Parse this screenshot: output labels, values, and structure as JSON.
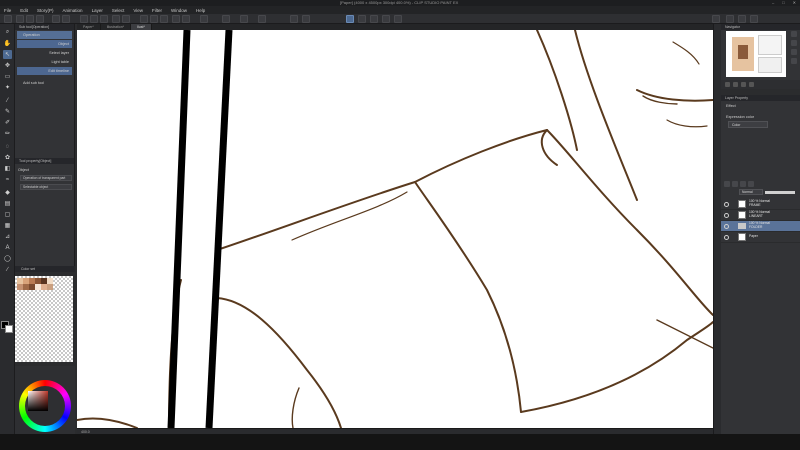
{
  "window": {
    "title": "[Paper] (4000 x 4500px 300dpi 400.0%) - CLIP STUDIO PAINT EX"
  },
  "menu": [
    "File",
    "Edit",
    "Story(P)",
    "Animation",
    "Layer",
    "Select",
    "View",
    "Filter",
    "Window",
    "Help"
  ],
  "tabs": [
    {
      "label": "Paper*",
      "active": false
    },
    {
      "label": "Illustration*",
      "active": false
    },
    {
      "label": "Ilust*",
      "active": true
    }
  ],
  "sub_tool": {
    "header": "Sub tool[Operation]",
    "items": [
      "Operation",
      "Object",
      "Select layer",
      "Light table",
      "Edit timeline"
    ],
    "selected_index": 0,
    "add_label": "Add sub tool"
  },
  "tool_property": {
    "header": "Tool property[Object]",
    "section": "Object",
    "fields": [
      "Operation of transparent part",
      "Selectable object"
    ]
  },
  "color_palette": {
    "header": "Color set",
    "swatches": [
      "#e8c4a0",
      "#d9a37a",
      "#b87a52",
      "#8a5535",
      "#5a3520",
      "#f2dcc6",
      "#c69272",
      "#a06a48",
      "#7a4a2e",
      "#f6e6d6",
      "#e0b090",
      "#caa080"
    ]
  },
  "canvas": {
    "background": "#ffffff",
    "line_color": "#5a3a1e",
    "border_color": "#000000"
  },
  "navigator": {
    "header": "Navigator"
  },
  "layer_property": {
    "header": "Layer Property",
    "effect_label": "Effect",
    "expression_label": "Expression color",
    "expression_value": "Color"
  },
  "layers": {
    "blend_mode": "Normal",
    "rows": [
      {
        "name": "100 % Normal\nFRAME",
        "type": "layer",
        "selected": false
      },
      {
        "name": "100 % Normal\nLINEART",
        "type": "layer",
        "selected": false
      },
      {
        "name": "100 % Normal\nFOLDER",
        "type": "folder",
        "selected": true
      },
      {
        "name": "Paper",
        "type": "paper",
        "selected": false
      }
    ]
  },
  "bottom": {
    "zoom": "400.0"
  }
}
